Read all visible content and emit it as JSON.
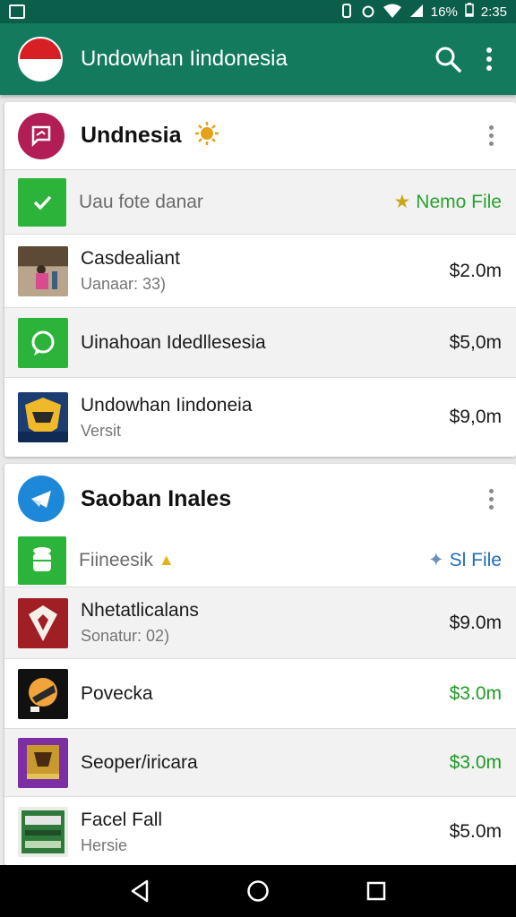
{
  "status_bar": {
    "battery": "16%",
    "time": "2:35"
  },
  "app_bar": {
    "title": "Undowhan Iindonesia",
    "search_icon": "search-icon",
    "overflow_icon": "more-vert-icon"
  },
  "section1": {
    "title": "Undnesia",
    "file_row": {
      "label": "Uau fote danar",
      "link": "Nemo File"
    },
    "items": [
      {
        "title": "Casdealiant",
        "subtitle": "Uanaar: 33)",
        "price": "$2.0m"
      },
      {
        "title": "Uinahoan Idedllesesia",
        "subtitle": "",
        "price": "$5,0m"
      },
      {
        "title": "Undowhan Iindoneia",
        "subtitle": "Versit",
        "price": "$9,0m"
      }
    ]
  },
  "section2": {
    "title": "Saoban Inales",
    "file_row": {
      "label": "Fiineesik",
      "link": "Sl File"
    },
    "items": [
      {
        "title": "Nhetatlicalans",
        "subtitle": "Sonatur: 02)",
        "price": "$9.0m"
      },
      {
        "title": "Povecka",
        "subtitle": "",
        "price": "$3.0m"
      },
      {
        "title": "Seoper/iricara",
        "subtitle": "",
        "price": "$3.0m"
      },
      {
        "title": "Facel Fall",
        "subtitle": "Hersie",
        "price": "$5.0m"
      }
    ]
  },
  "colors": {
    "primary": "#137a5d",
    "status": "#0b5e4a",
    "green_accent": "#1f9a25",
    "link_blue": "#1f6fb8"
  }
}
